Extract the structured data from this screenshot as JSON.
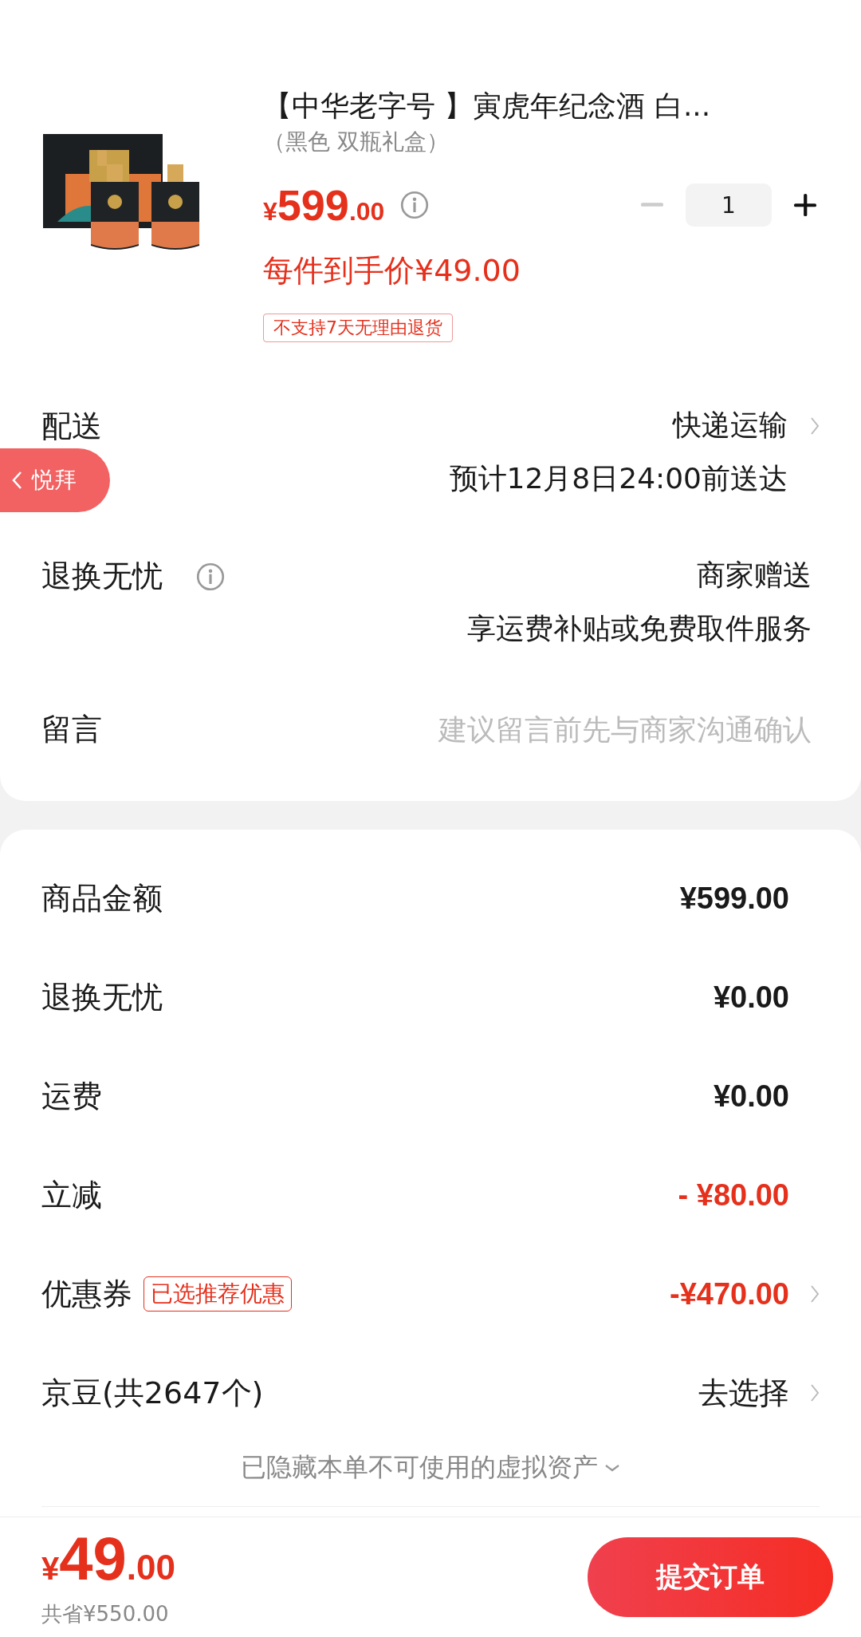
{
  "product": {
    "title": "【中华老字号 】寅虎年纪念酒 白...",
    "variant": "（黑色 双瓶礼盒）",
    "price_symbol": "¥",
    "price_int": "599",
    "price_dec": ".00",
    "final_price": "每件到手价¥49.00",
    "quantity": "1",
    "minus_disabled": true,
    "tag": "不支持7天无理由退货"
  },
  "delivery": {
    "label": "配送",
    "method": "快递运输",
    "eta": "预计12月8日24:00前送达"
  },
  "return_service": {
    "label": "退换无忧",
    "value": "商家赠送",
    "note": "享运费补贴或免费取件服务"
  },
  "message": {
    "label": "留言",
    "placeholder": "建议留言前先与商家沟通确认"
  },
  "float_badge": {
    "label": "悦拜"
  },
  "summary": [
    {
      "kind": "amount",
      "label": "商品金额",
      "value": "¥599.00",
      "discount": false,
      "chevron": false
    },
    {
      "kind": "amount",
      "label": "退换无忧",
      "value": "¥0.00",
      "discount": false,
      "chevron": false
    },
    {
      "kind": "amount",
      "label": "运费",
      "value": "¥0.00",
      "discount": false,
      "chevron": false
    },
    {
      "kind": "amount",
      "label": "立减",
      "value": "- ¥80.00",
      "discount": true,
      "chevron": false
    },
    {
      "kind": "amount",
      "label": "优惠券",
      "tag": "已选推荐优惠",
      "value": "-¥470.00",
      "discount": true,
      "chevron": true
    },
    {
      "kind": "action",
      "label": "京豆(共2647个)",
      "value": "去选择",
      "discount": false,
      "chevron": true
    }
  ],
  "hidden_notice": "已隐藏本单不可使用的虚拟资产",
  "bottom_bar": {
    "symbol": "¥",
    "total_int": "49",
    "total_dec": ".00",
    "saved": "共省¥550.00",
    "submit": "提交订单"
  }
}
